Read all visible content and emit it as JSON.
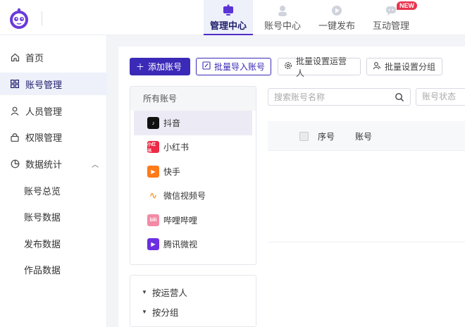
{
  "top_nav": {
    "tabs": [
      {
        "label": "管理中心",
        "icon": "monitor-icon",
        "active": true
      },
      {
        "label": "账号中心",
        "icon": "account-icon"
      },
      {
        "label": "一键发布",
        "icon": "publish-icon"
      },
      {
        "label": "互动管理",
        "icon": "chat-icon"
      }
    ],
    "new_badge": "NEW"
  },
  "sidebar": {
    "items": [
      {
        "label": "首页",
        "icon": "home-icon"
      },
      {
        "label": "账号管理",
        "icon": "grid-icon",
        "active": true
      },
      {
        "label": "人员管理",
        "icon": "user-icon"
      },
      {
        "label": "权限管理",
        "icon": "lock-icon"
      },
      {
        "label": "数据统计",
        "icon": "pie-icon",
        "expanded": true
      }
    ],
    "sub_items": [
      "账号总览",
      "账号数据",
      "发布数据",
      "作品数据"
    ]
  },
  "toolbar": {
    "add_account": "添加账号",
    "batch_import": "批量导入账号",
    "batch_operator": "批量设置运营人",
    "batch_group": "批量设置分组"
  },
  "platforms": {
    "header": "所有账号",
    "items": [
      {
        "label": "抖音",
        "color": "#111111",
        "glyph": "♪",
        "active": true
      },
      {
        "label": "小红书",
        "color": "#ee2a45",
        "glyph": "小红书"
      },
      {
        "label": "快手",
        "color": "#ff7a1a",
        "glyph": "▶"
      },
      {
        "label": "微信视频号",
        "color": "#f2a33c",
        "glyph": "∿"
      },
      {
        "label": "哔哩哔哩",
        "color": "#f28aa6",
        "glyph": "bili"
      },
      {
        "label": "腾讯微视",
        "color": "#6b2fe0",
        "glyph": "▶"
      }
    ]
  },
  "groups": {
    "by_operator": "按运营人",
    "by_group": "按分组"
  },
  "search": {
    "placeholder": "搜索账号名称",
    "status_placeholder": "账号状态"
  },
  "table": {
    "columns": [
      "序号",
      "账号"
    ]
  },
  "colors": {
    "primary": "#3a2ab7",
    "badge": "#e8344d"
  }
}
